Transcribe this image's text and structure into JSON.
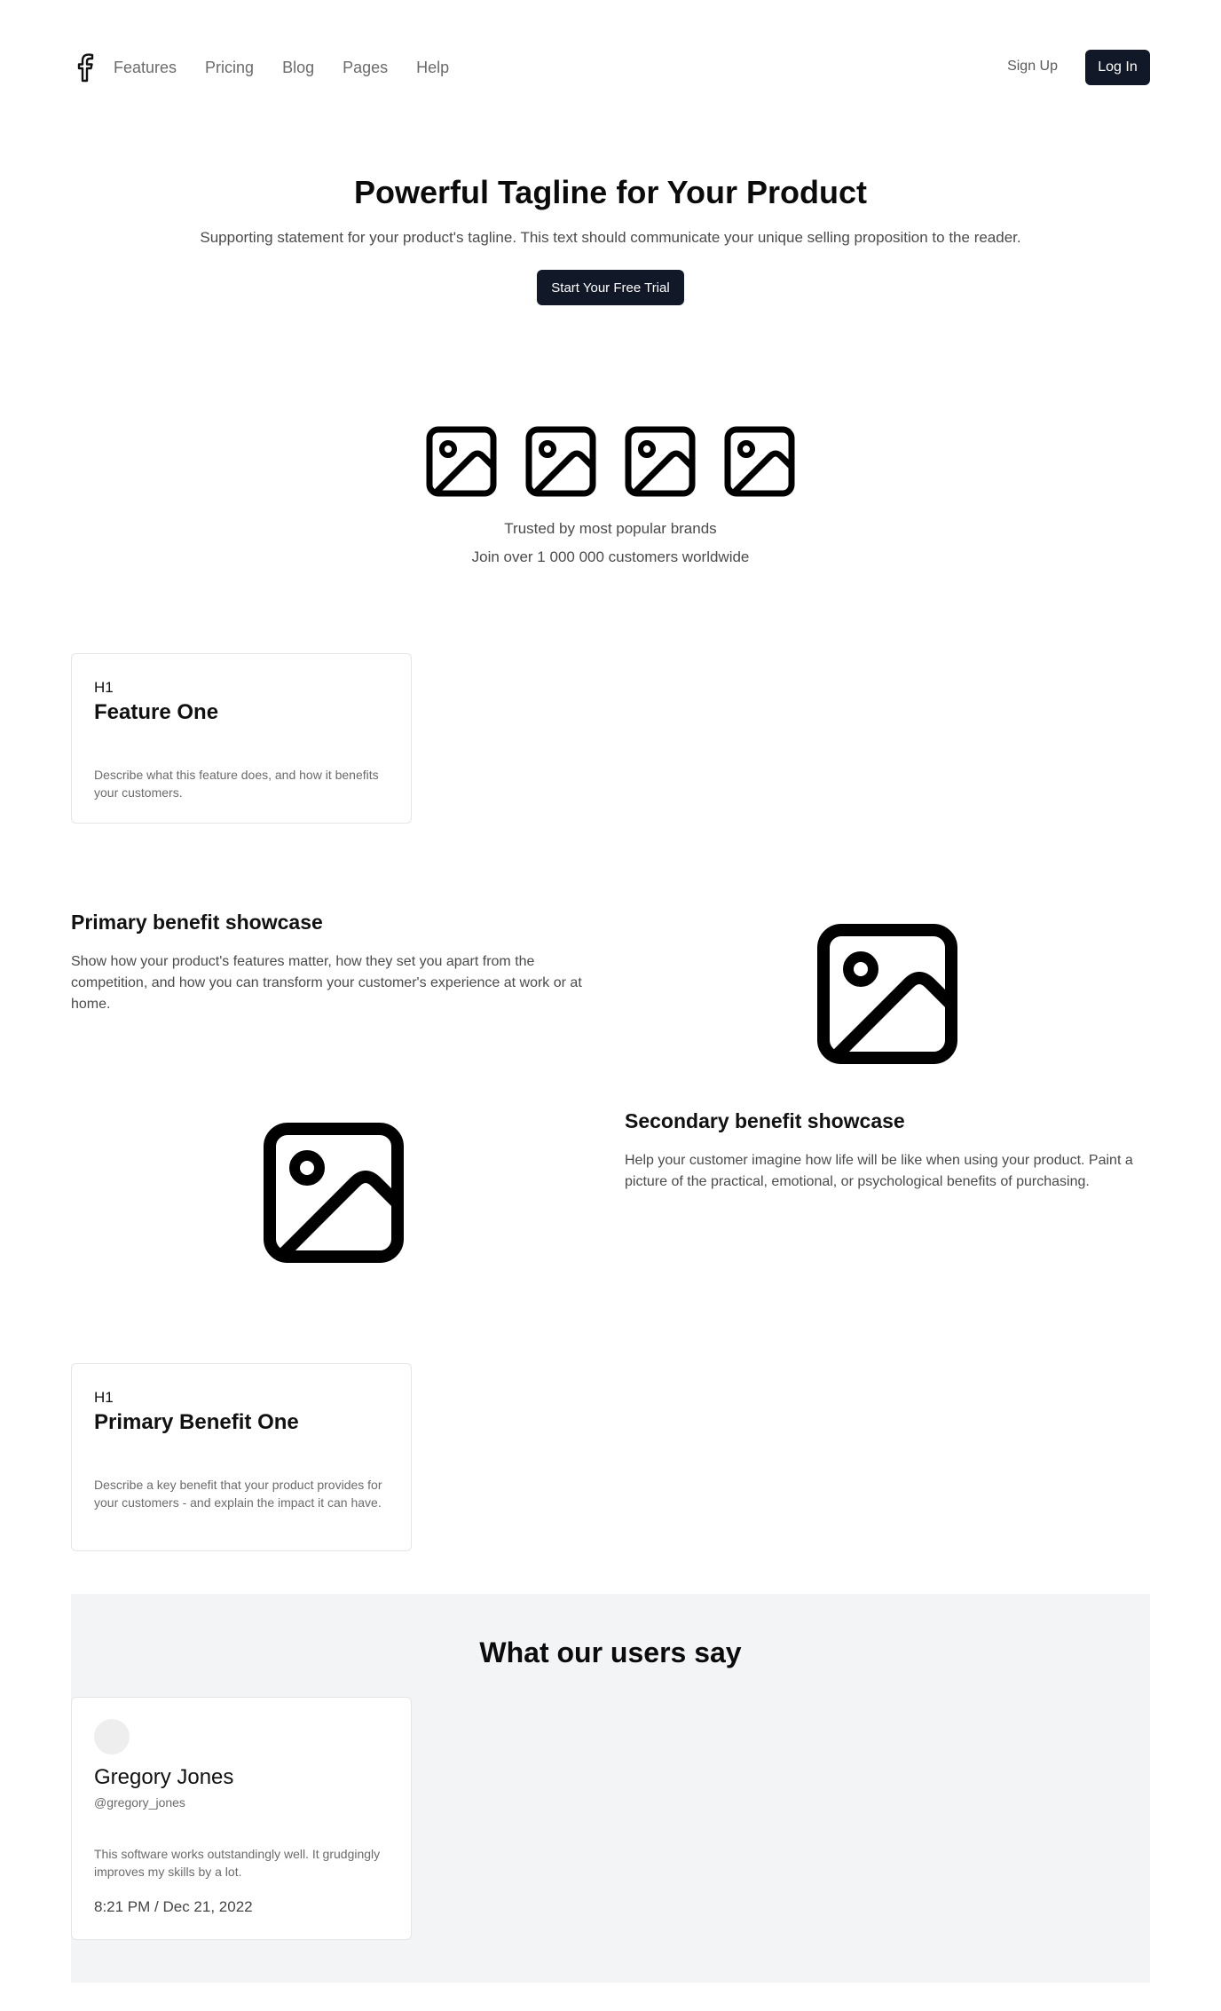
{
  "nav": {
    "links": [
      "Features",
      "Pricing",
      "Blog",
      "Pages",
      "Help"
    ],
    "signup_label": "Sign Up",
    "login_label": "Log In",
    "logo_icon": "facebook-icon"
  },
  "hero": {
    "title": "Powerful Tagline for Your Product",
    "subtitle": "Supporting statement for your product's tagline. This text should communicate your unique selling proposition to the reader.",
    "cta_label": "Start Your Free Trial"
  },
  "brands": {
    "logos": [
      "image-icon",
      "image-icon",
      "image-icon",
      "image-icon"
    ],
    "trusted_text": "Trusted by most popular brands",
    "join_text": "Join over 1 000 000 customers worldwide"
  },
  "feature_card": {
    "heading_icon": "H1",
    "title": "Feature One",
    "description": "Describe what this feature does, and how it benefits your customers."
  },
  "primary_showcase": {
    "title": "Primary benefit showcase",
    "description": "Show how your product's features matter, how they set you apart from the competition, and how you can transform your customer's experience at work or at home."
  },
  "secondary_showcase": {
    "title": "Secondary benefit showcase",
    "description": "Help your customer imagine how life will be like when using your product. Paint a picture of the practical, emotional, or psychological benefits of purchasing."
  },
  "benefit_card": {
    "heading_icon": "H1",
    "title": "Primary Benefit One",
    "description": "Describe a key benefit that your product provides for your customers - and explain the impact it can have."
  },
  "testimonials": {
    "title": "What our users say",
    "items": [
      {
        "name": "Gregory Jones",
        "handle": "@gregory_jones",
        "quote": "This software works outstandingly well. It grudgingly improves my skills by a lot.",
        "timestamp": "8:21 PM / Dec 21, 2022"
      }
    ]
  },
  "colors": {
    "primary_dark": "#111827",
    "muted_bg": "#f3f4f6",
    "border": "#e5e5e5"
  }
}
